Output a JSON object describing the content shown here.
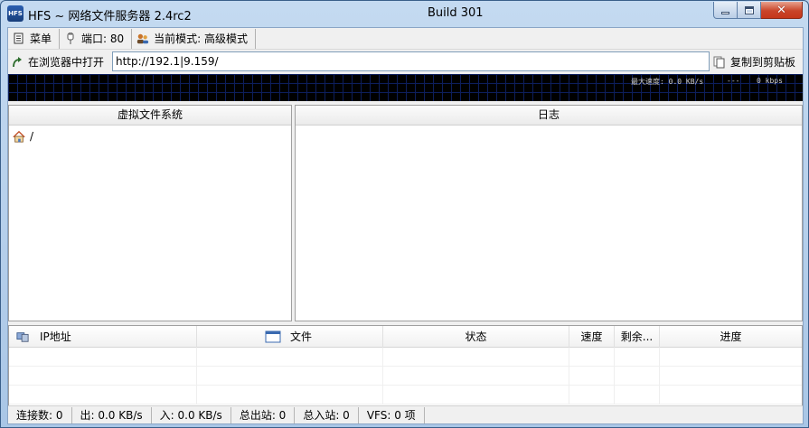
{
  "window": {
    "icon_text": "HFS",
    "title": "HFS ~ 网络文件服务器 2.4rc2",
    "build": "Build 301",
    "controls": {
      "minimize": "minimize",
      "maximize": "maximize",
      "close": "✕"
    }
  },
  "toolbar": {
    "menu_label": "菜单",
    "port_label": "端口: 80",
    "mode_label": "当前模式: 高级模式"
  },
  "addressbar": {
    "open_label": "在浏览器中打开",
    "url": "http://192.1|9.159/",
    "copy_label": "复制到剪贴板"
  },
  "graph": {
    "max_speed": "最大速度: 0.0 KB/s",
    "dashes": "---",
    "kbps": "0 kbps"
  },
  "vfs_panel": {
    "header": "虚拟文件系统",
    "root_label": "/"
  },
  "log_panel": {
    "header": "日志"
  },
  "transfers": {
    "columns": {
      "ip": "IP地址",
      "file": "文件",
      "status": "状态",
      "speed": "速度",
      "remaining": "剩余...",
      "progress": "进度"
    }
  },
  "statusbar": {
    "connections": "连接数: 0",
    "out": "出: 0.0 KB/s",
    "in": "入: 0.0 KB/s",
    "total_out": "总出站: 0",
    "total_in": "总入站: 0",
    "vfs": "VFS: 0 项"
  },
  "colors": {
    "graph_bg": "#000000",
    "graph_grid": "#0d1e5c",
    "title_bg": "#b9d1ea",
    "close_red": "#c5361a"
  }
}
